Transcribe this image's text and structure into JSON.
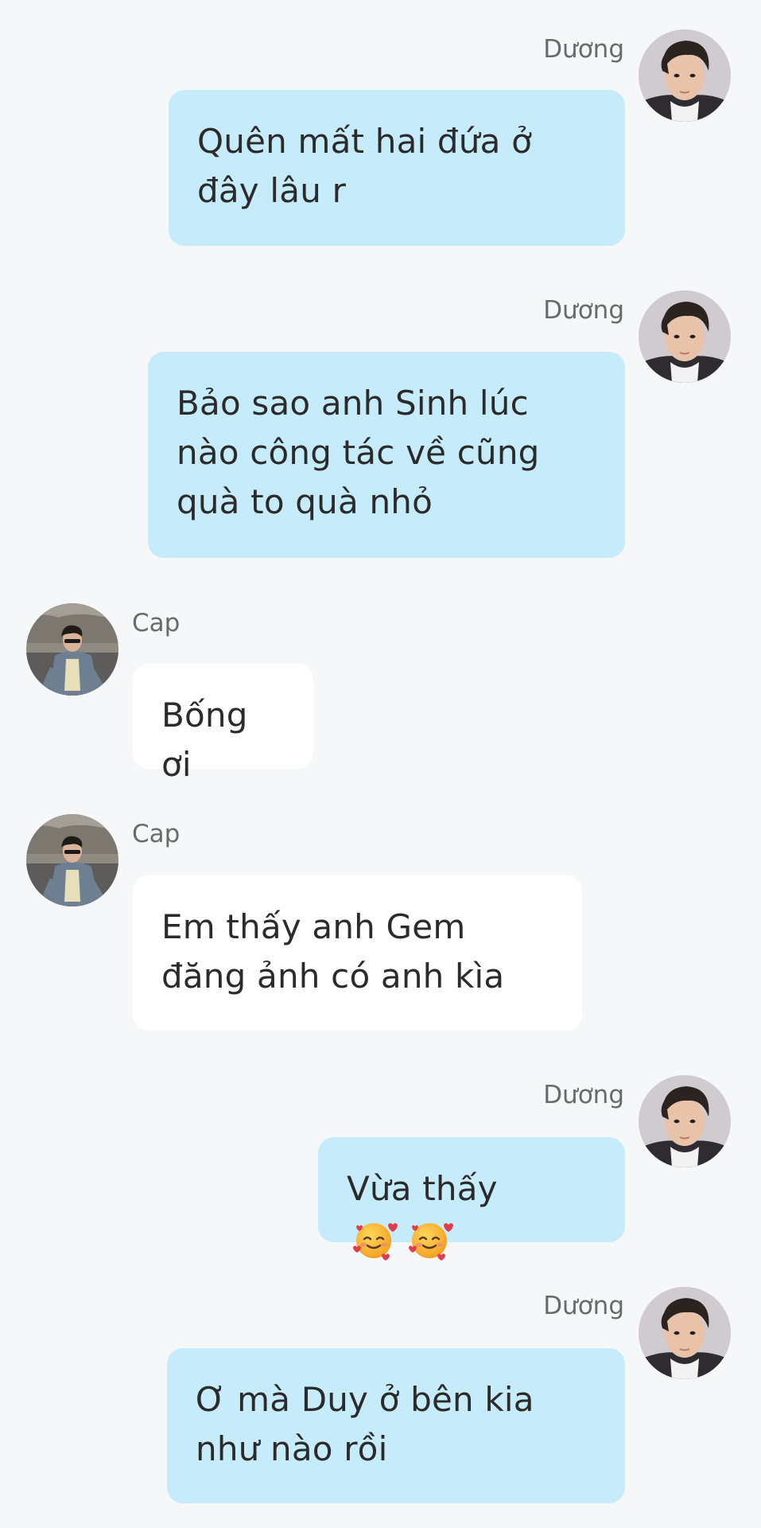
{
  "messages": [
    {
      "sender": "Dương",
      "direction": "out",
      "text": "Quên mất hai đứa ở đây lâu r"
    },
    {
      "sender": "Dương",
      "direction": "out",
      "text": "Bảo sao anh Sinh lúc nào công tác về cũng quà to quà nhỏ"
    },
    {
      "sender": "Cap",
      "direction": "in",
      "text": "Bống ơi"
    },
    {
      "sender": "Cap",
      "direction": "in",
      "text": "Em thấy anh Gem đăng ảnh có anh kìa"
    },
    {
      "sender": "Dương",
      "direction": "out",
      "text": "Vừa thấy",
      "emoji": [
        "smiling-face-with-hearts",
        "smiling-face-with-hearts"
      ]
    },
    {
      "sender": "Dương",
      "direction": "out",
      "text": "Ơ mà Duy ở bên kia như nào rồi"
    }
  ],
  "colors": {
    "background": "#f6f7f9",
    "outgoing_bubble": "#c6ecfb",
    "incoming_bubble": "#ffffff",
    "sender_name": "#6a6a6a",
    "message_text": "#2b2b2b"
  },
  "avatars": {
    "duong": "avatar-photo-icon",
    "cap": "avatar-photo-icon"
  }
}
